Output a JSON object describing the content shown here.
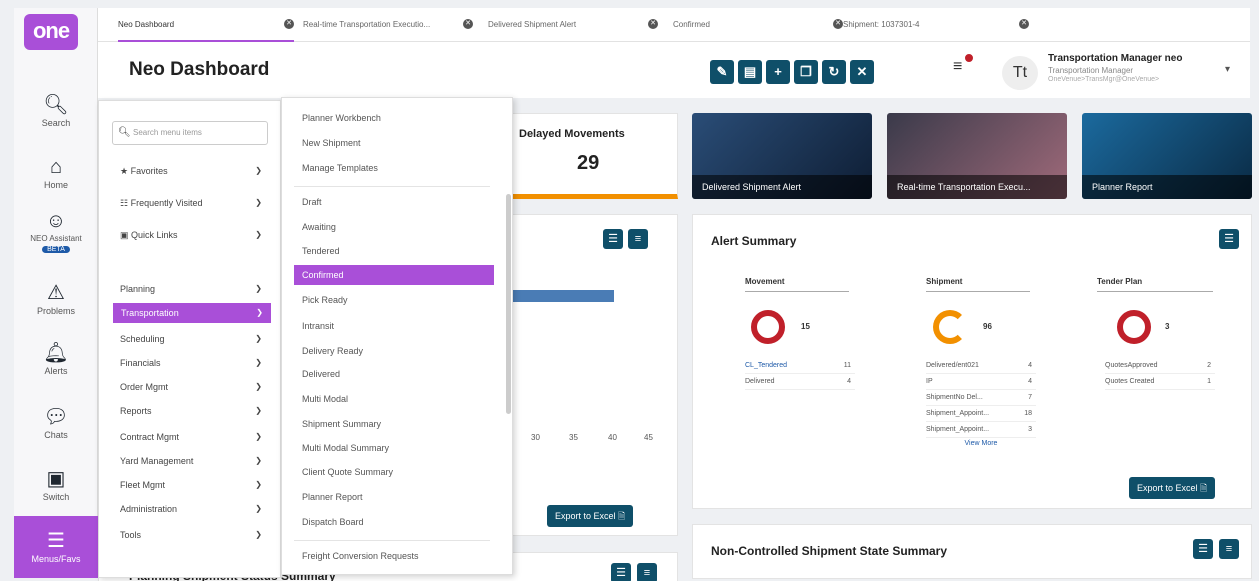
{
  "rail": {
    "logo": "one",
    "items": [
      {
        "label": "Search",
        "icon": "search-icon"
      },
      {
        "label": "Home",
        "icon": "home-icon"
      },
      {
        "label": "NEO Assistant",
        "icon": "assistant-icon",
        "badge": "BETA"
      },
      {
        "label": "Problems",
        "icon": "warning-icon"
      },
      {
        "label": "Alerts",
        "icon": "bell-icon"
      },
      {
        "label": "Chats",
        "icon": "chat-icon"
      },
      {
        "label": "Switch",
        "icon": "switch-icon"
      },
      {
        "label": "Menus/Favs",
        "icon": "menu-icon"
      }
    ]
  },
  "tabs": [
    {
      "label": "Neo Dashboard"
    },
    {
      "label": "Real-time Transportation Executio..."
    },
    {
      "label": "Delivered Shipment Alert"
    },
    {
      "label": "Confirmed"
    },
    {
      "label": "Shipment: 1037301-4"
    }
  ],
  "header": {
    "title": "Neo Dashboard",
    "user_name": "Transportation Manager neo",
    "user_role": "Transportation Manager",
    "user_org": "OneVenue>TransMgr@OneVenue>",
    "avatar": "Tt"
  },
  "delayed": {
    "title": "Delayed Movements",
    "value": "29"
  },
  "tiles": [
    {
      "label": "Delivered Shipment Alert"
    },
    {
      "label": "Real-time Transportation Execu..."
    },
    {
      "label": "Planner Report"
    }
  ],
  "chart": {
    "ticks": [
      "30",
      "35",
      "40",
      "45"
    ],
    "export": "Export to Excel"
  },
  "alert_summary": {
    "title": "Alert Summary",
    "export": "Export to Excel",
    "groups": [
      {
        "title": "Movement",
        "total": "15",
        "rows": [
          {
            "label": "CL_Tendered",
            "value": "11"
          },
          {
            "label": "Delivered",
            "value": "4"
          }
        ]
      },
      {
        "title": "Shipment",
        "total": "96",
        "rows": [
          {
            "label": "Delivered/ent021",
            "value": "4"
          },
          {
            "label": "IP",
            "value": "4"
          },
          {
            "label": "ShipmentNo Del...",
            "value": "7"
          },
          {
            "label": "Shipment_Appoint...",
            "value": "18"
          },
          {
            "label": "Shipment_Appoint...",
            "value": "3"
          }
        ],
        "more": "View More"
      },
      {
        "title": "Tender Plan",
        "total": "3",
        "rows": [
          {
            "label": "QuotesApproved",
            "value": "2"
          },
          {
            "label": "Quotes Created",
            "value": "1"
          }
        ]
      }
    ]
  },
  "non_controlled": {
    "title": "Non-Controlled Shipment State Summary"
  },
  "planning_summary": {
    "title": "Planning Shipment Status Summary"
  },
  "menu1": {
    "search_placeholder": "Search menu items",
    "top": [
      {
        "label": "Favorites",
        "icon": "star-icon"
      },
      {
        "label": "Frequently Visited",
        "icon": "list-icon"
      },
      {
        "label": "Quick Links",
        "icon": "link-icon"
      }
    ],
    "items": [
      {
        "label": "Planning"
      },
      {
        "label": "Transportation"
      },
      {
        "label": "Scheduling"
      },
      {
        "label": "Financials"
      },
      {
        "label": "Order Mgmt"
      },
      {
        "label": "Reports"
      },
      {
        "label": "Contract Mgmt"
      },
      {
        "label": "Yard Management"
      },
      {
        "label": "Fleet Mgmt"
      },
      {
        "label": "Administration"
      },
      {
        "label": "Tools"
      }
    ]
  },
  "menu2": {
    "group1": [
      "Planner Workbench",
      "New Shipment",
      "Manage Templates"
    ],
    "group2": [
      "Draft",
      "Awaiting",
      "Tendered",
      "Confirmed",
      "Pick Ready",
      "Intransit",
      "Delivery Ready",
      "Delivered",
      "Multi Modal",
      "Shipment Summary",
      "Multi Modal Summary",
      "Client Quote Summary",
      "Planner Report",
      "Dispatch Board"
    ],
    "group3": [
      "Freight Conversion Requests"
    ]
  }
}
